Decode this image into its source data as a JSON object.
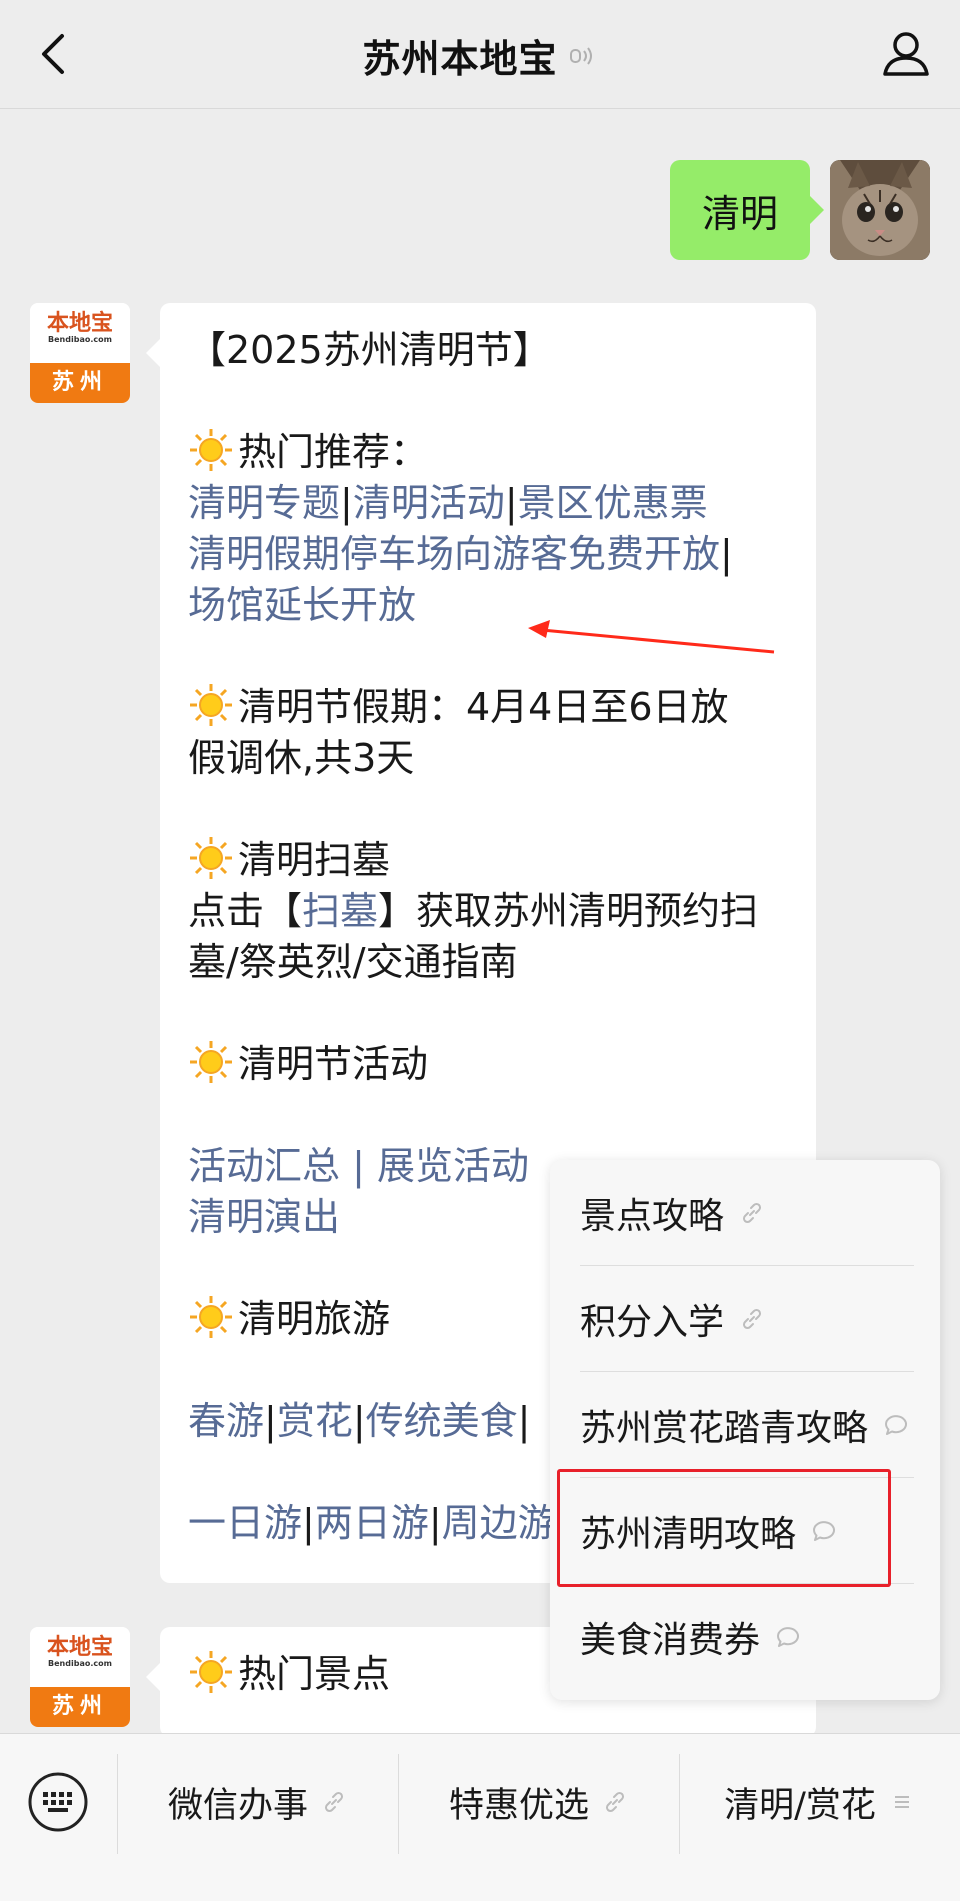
{
  "header": {
    "title": "苏州本地宝",
    "back_icon": "chevron-left-icon",
    "listen_icon": "sound-wave-icon",
    "user_icon": "user-profile-icon"
  },
  "outgoing_message": {
    "text": "清明"
  },
  "logo": {
    "top_text": "本地宝",
    "url_text": "Bendibao.com",
    "bottom_text": "苏州"
  },
  "reply": {
    "title": "【2025苏州清明节】",
    "hot_label": "热门推荐：",
    "hot_links": [
      "清明专题",
      "清明活动",
      "景区优惠票",
      "清明假期停车场向游客免费开放",
      "场馆延长开放"
    ],
    "sep": "|",
    "holiday_line1": "清明节假期：4月4日至6日放",
    "holiday_line2": "假调休,共3天",
    "tomb_title": "清明扫墓",
    "tomb_pre": "点击【",
    "tomb_link": "扫墓",
    "tomb_post": "】获取苏州清明预约扫",
    "tomb_line2": "墓/祭英烈/交通指南",
    "events_title": "清明节活动",
    "events_link1": "活动汇总",
    "events_sep": " | ",
    "events_link2": "展览活动",
    "events_link3": "清明演出",
    "travel_title": "清明旅游",
    "travel_links": [
      "春游",
      "赏花",
      "传统美食"
    ],
    "trip_links": [
      "一日游",
      "两日游",
      "周边游"
    ]
  },
  "second_message": {
    "title": "热门景点"
  },
  "popup_menu": {
    "items": [
      {
        "label": "景点攻略",
        "icon": "link-icon"
      },
      {
        "label": "积分入学",
        "icon": "link-icon"
      },
      {
        "label": "苏州赏花踏青攻略",
        "icon": "chat-bubble-icon"
      },
      {
        "label": "苏州清明攻略",
        "icon": "chat-bubble-icon"
      },
      {
        "label": "美食消费券",
        "icon": "chat-bubble-icon"
      }
    ]
  },
  "bottom_menu": {
    "keyboard_icon": "keyboard-icon",
    "items": [
      {
        "label": "微信办事",
        "icon": "link-icon"
      },
      {
        "label": "特惠优选",
        "icon": "link-icon"
      },
      {
        "label": "清明/赏花",
        "icon": "menu-lines-icon"
      }
    ]
  },
  "colors": {
    "link": "#576b95",
    "outgoing_bubble": "#95ec69",
    "brand_orange": "#f07a12",
    "highlight": "#e8202a"
  }
}
